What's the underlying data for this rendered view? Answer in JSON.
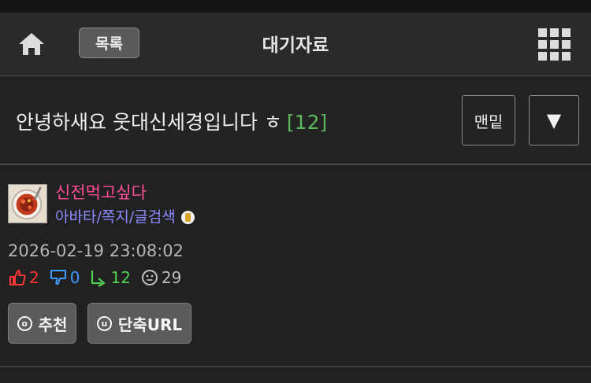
{
  "header": {
    "list_label": "목록",
    "title": "대기자료",
    "icons": [
      "home-icon",
      "grid-menu-icon"
    ]
  },
  "post": {
    "title": "안녕하새요 웃대신세경입니다 ㅎ",
    "comment_count": "[12]",
    "bottom_label": "맨밑",
    "down_label": "▼"
  },
  "author": {
    "name": "신전먹고싶다",
    "links": [
      "아바타",
      "쪽지",
      "글검색"
    ],
    "separator": "/",
    "avatar_icon": "avatar-image",
    "badge_icon": "level-badge-icon"
  },
  "meta": {
    "date": "2026-02-19 23:08:02",
    "likes": "2",
    "dislikes": "0",
    "shares": "12",
    "views": "29"
  },
  "actions": {
    "recommend_icon": "ⓞ",
    "recommend_label": "추천",
    "shorturl_icon": "ⓤ",
    "shorturl_label": "단축URL"
  },
  "colors": {
    "background": "#212121",
    "header": "#2a2a2a",
    "author": "#ff4d98",
    "links": "#8c8cff",
    "comment_count": "#5cb85c",
    "like": "#ff3636",
    "dislike": "#3f9bff",
    "share": "#52cf52"
  }
}
